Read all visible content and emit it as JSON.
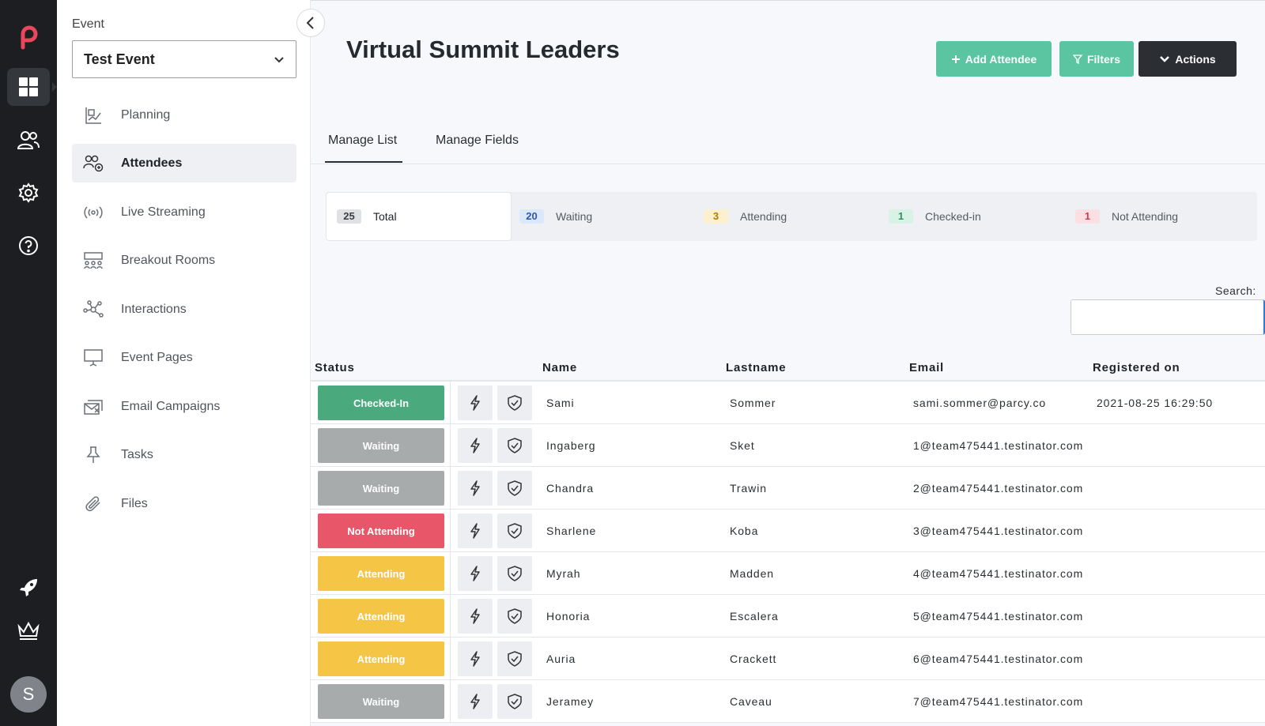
{
  "sidebar": {
    "event_label": "Event",
    "event_value": "Test Event",
    "items": [
      {
        "label": "Planning",
        "icon": "planning-icon"
      },
      {
        "label": "Attendees",
        "icon": "attendees-icon",
        "active": true
      },
      {
        "label": "Live Streaming",
        "icon": "live-streaming-icon"
      },
      {
        "label": "Breakout Rooms",
        "icon": "breakout-rooms-icon"
      },
      {
        "label": "Interactions",
        "icon": "interactions-icon"
      },
      {
        "label": "Event Pages",
        "icon": "event-pages-icon"
      },
      {
        "label": "Email Campaigns",
        "icon": "email-campaigns-icon"
      },
      {
        "label": "Tasks",
        "icon": "tasks-icon"
      },
      {
        "label": "Files",
        "icon": "files-icon"
      }
    ]
  },
  "rail": {
    "avatar_initial": "S",
    "icons": [
      "dashboard-icon",
      "users-icon",
      "settings-icon",
      "help-icon",
      "rocket-icon",
      "crown-icon"
    ]
  },
  "header": {
    "title": "Virtual Summit Leaders",
    "add_attendee": "Add Attendee",
    "filters": "Filters",
    "actions": "Actions"
  },
  "tabs": [
    {
      "label": "Manage List",
      "active": true
    },
    {
      "label": "Manage Fields"
    }
  ],
  "counts": [
    {
      "num": "25",
      "label": "Total",
      "bg": "#dfe1e5",
      "fg": "#3a3f45"
    },
    {
      "num": "20",
      "label": "Waiting",
      "bg": "#dbe7fb",
      "fg": "#2f55b5"
    },
    {
      "num": "3",
      "label": "Attending",
      "bg": "#fdf0cf",
      "fg": "#b27a00"
    },
    {
      "num": "1",
      "label": "Checked-in",
      "bg": "#d9f2e6",
      "fg": "#2b9160"
    },
    {
      "num": "1",
      "label": "Not Attending",
      "bg": "#fbe0e3",
      "fg": "#cf3b4c"
    }
  ],
  "search": {
    "label": "Search:",
    "value": ""
  },
  "table": {
    "headers": {
      "status": "Status",
      "name": "Name",
      "lastname": "Lastname",
      "email": "Email",
      "registered": "Registered on"
    },
    "rows": [
      {
        "status": "Checked-In",
        "color": "#4aaa7e",
        "name": "Sami",
        "lastname": "Sommer",
        "email": "sami.sommer@parcy.co",
        "registered": "2021-08-25 16:29:50"
      },
      {
        "status": "Waiting",
        "color": "#a7abac",
        "name": "Ingaberg",
        "lastname": "Sket",
        "email": "1@team475441.testinator.com",
        "registered": ""
      },
      {
        "status": "Waiting",
        "color": "#a7abac",
        "name": "Chandra",
        "lastname": "Trawin",
        "email": "2@team475441.testinator.com",
        "registered": ""
      },
      {
        "status": "Not Attending",
        "color": "#e8566a",
        "name": "Sharlene",
        "lastname": "Koba",
        "email": "3@team475441.testinator.com",
        "registered": ""
      },
      {
        "status": "Attending",
        "color": "#f5c645",
        "name": "Myrah",
        "lastname": "Madden",
        "email": "4@team475441.testinator.com",
        "registered": ""
      },
      {
        "status": "Attending",
        "color": "#f5c645",
        "name": "Honoria",
        "lastname": "Escalera",
        "email": "5@team475441.testinator.com",
        "registered": ""
      },
      {
        "status": "Attending",
        "color": "#f5c645",
        "name": "Auria",
        "lastname": "Crackett",
        "email": "6@team475441.testinator.com",
        "registered": ""
      },
      {
        "status": "Waiting",
        "color": "#a7abac",
        "name": "Jeramey",
        "lastname": "Caveau",
        "email": "7@team475441.testinator.com",
        "registered": ""
      }
    ]
  },
  "colors": {
    "accent": "#5bc4a0",
    "dark": "#2b2e33",
    "rail": "#1c1e21",
    "logo": "#e8475c"
  }
}
